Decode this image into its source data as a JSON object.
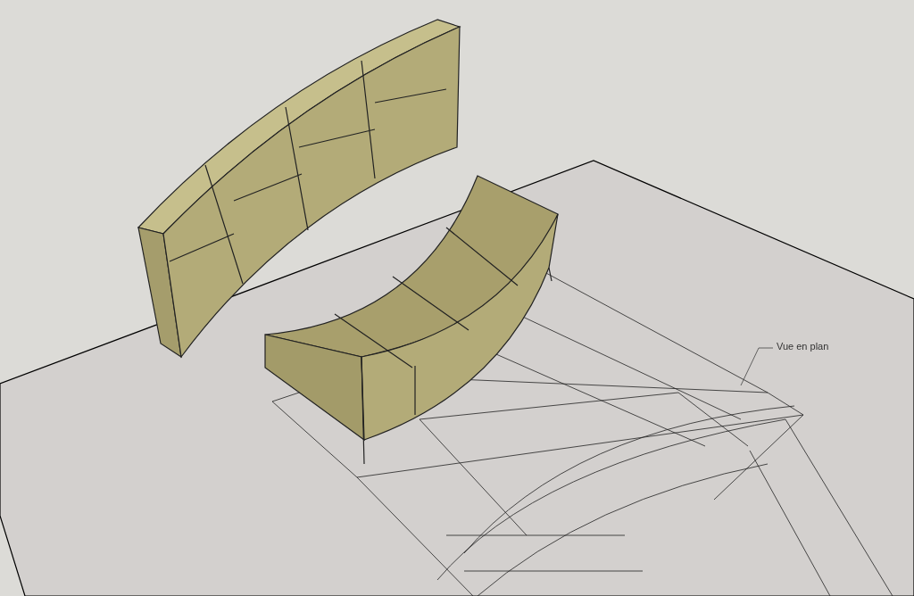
{
  "annotation": {
    "text": "Vue en plan"
  }
}
